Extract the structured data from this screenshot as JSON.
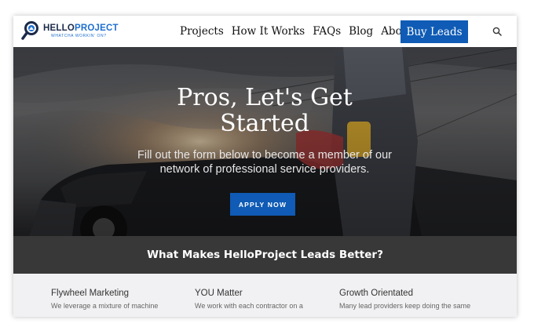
{
  "brand": {
    "name_part1": "HELLO",
    "name_part2": "PROJECT",
    "tagline": "WHATCHA WORKIN' ON?"
  },
  "nav": {
    "items": [
      "Projects",
      "How It Works",
      "FAQs",
      "Blog",
      "About"
    ],
    "cta_label": "Buy Leads"
  },
  "hero": {
    "title": "Pros, Let's Get Started",
    "subtitle": "Fill out the form below to become a member of our network of professional service providers.",
    "button_label": "APPLY NOW"
  },
  "band": {
    "title": "What Makes HelloProject Leads Better?"
  },
  "features": [
    {
      "title": "Flywheel Marketing",
      "text": "We leverage a mixture of machine"
    },
    {
      "title": "YOU Matter",
      "text": "We work with each contractor on a"
    },
    {
      "title": "Growth Orientated",
      "text": "Many lead providers keep doing the same"
    }
  ],
  "colors": {
    "brand_blue": "#0f5bb5",
    "brand_navy": "#1b2a4a",
    "band_bg": "#383838",
    "feature_bg": "#f1f1f3"
  }
}
